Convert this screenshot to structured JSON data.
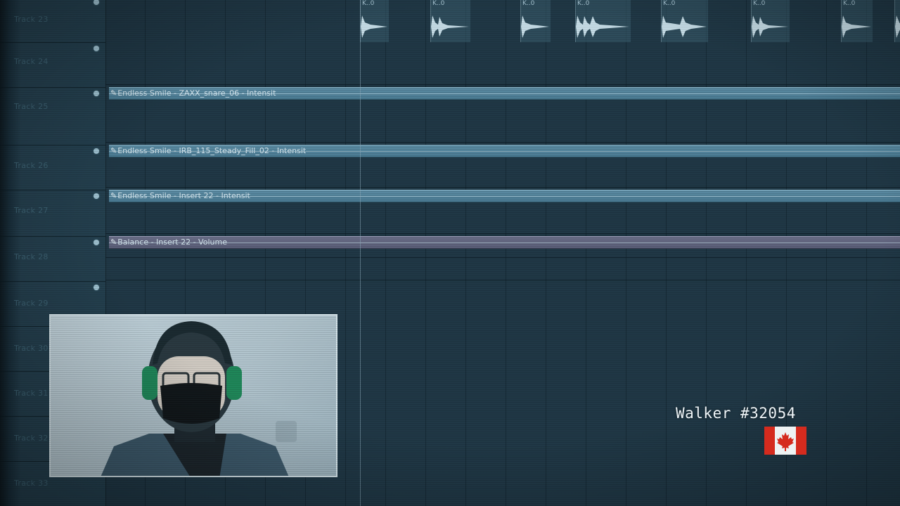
{
  "tracks": [
    {
      "label": "Track 23"
    },
    {
      "label": "Track 24"
    },
    {
      "label": "Track 25"
    },
    {
      "label": "Track 26"
    },
    {
      "label": "Track 27"
    },
    {
      "label": "Track 28"
    },
    {
      "label": "Track 29"
    },
    {
      "label": "Track 30"
    },
    {
      "label": "Track 31"
    },
    {
      "label": "Track 32"
    },
    {
      "label": "Track 33"
    }
  ],
  "automation_clips": [
    {
      "name": "Endless Smile - ZAXX_snare_06 - Intensit",
      "kind": "intensity",
      "color": "#5b8ba2"
    },
    {
      "name": "Endless Smile - IRB_115_Steady_Fill_02 - Intensit",
      "kind": "intensity",
      "color": "#5b8ba2"
    },
    {
      "name": "Endless Smile - Insert 22 - Intensit",
      "kind": "intensity",
      "color": "#5b8ba2"
    },
    {
      "name": "Balance - Insert 22 - Volume",
      "kind": "volume",
      "color": "#6b6f89"
    }
  ],
  "audio_clip_titles": [
    "K..0",
    "K..0",
    "K..0",
    "K..0",
    "K..0",
    "K..0",
    "K..0"
  ],
  "overlay": {
    "credit_text": "Walker #32054",
    "flag": "canada-flag-icon",
    "flag_color": "#d52b1e"
  },
  "icons": {
    "pencil": "✎",
    "track_dot": "enable-dot-icon"
  }
}
